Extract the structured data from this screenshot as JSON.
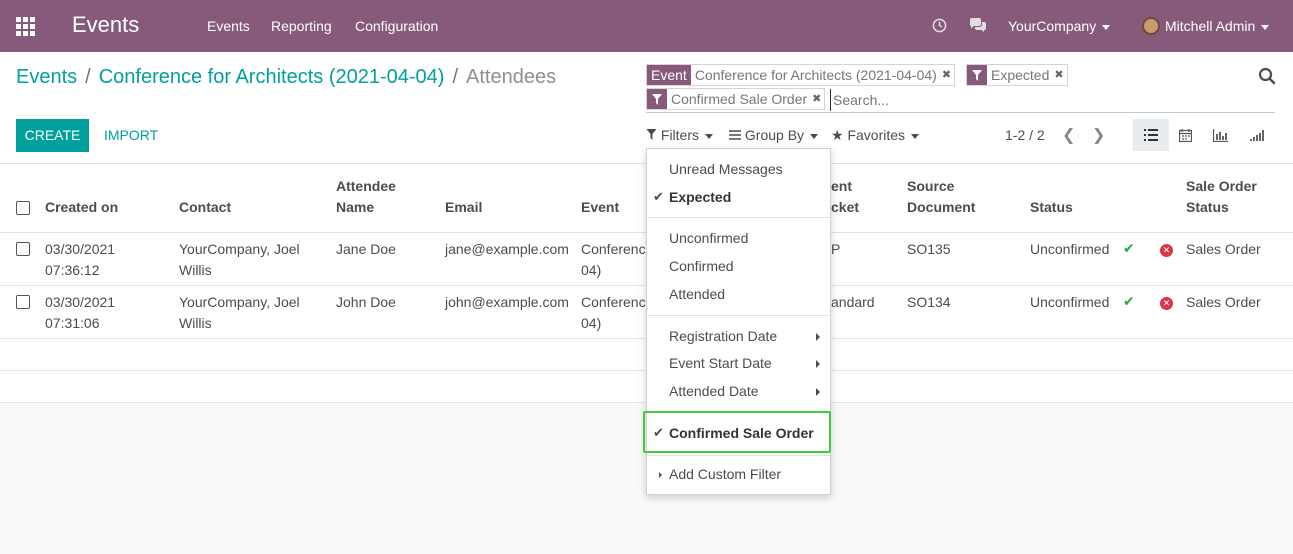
{
  "navbar": {
    "brand": "Events",
    "menu": [
      "Events",
      "Reporting",
      "Configuration"
    ],
    "company": "YourCompany",
    "user": "Mitchell Admin"
  },
  "breadcrumb": {
    "root": "Events",
    "event": "Conference for Architects (2021-04-04)",
    "current": "Attendees"
  },
  "buttons": {
    "create": "CREATE",
    "import": "IMPORT"
  },
  "search": {
    "facets": [
      {
        "category": "Event",
        "value": "Conference for Architects (2021-04-04)"
      },
      {
        "category": "filter-icon",
        "value": "Expected"
      },
      {
        "category": "filter-icon",
        "value": "Confirmed Sale Order"
      }
    ],
    "placeholder": "Search..."
  },
  "toolbar": {
    "filters": "Filters",
    "group_by": "Group By",
    "favorites": "Favorites"
  },
  "pager": {
    "range": "1-2 / 2"
  },
  "table": {
    "columns": [
      "Created on",
      "Contact",
      "Attendee Name",
      "Email",
      "Event",
      "Event Ticket",
      "Source Document",
      "Status",
      "Sale Order Status"
    ],
    "header_lines": {
      "attendee": [
        "Attendee",
        "Name"
      ],
      "ticket": [
        "ent",
        "cket"
      ],
      "source": [
        "Source",
        "Document"
      ],
      "so_status": [
        "Sale Order",
        "Status"
      ]
    },
    "rows": [
      {
        "created_date": "03/30/2021",
        "created_time": "07:36:12",
        "contact_1": "YourCompany, Joel",
        "contact_2": "Willis",
        "name": "Jane Doe",
        "email": "jane@example.com",
        "event_1": "Conferenc",
        "event_2": "04)",
        "ticket": "P",
        "source": "SO135",
        "status": "Unconfirmed",
        "so_status": "Sales Order"
      },
      {
        "created_date": "03/30/2021",
        "created_time": "07:31:06",
        "contact_1": "YourCompany, Joel",
        "contact_2": "Willis",
        "name": "John Doe",
        "email": "john@example.com",
        "event_1": "Conferenc",
        "event_2": "04)",
        "ticket": "andard",
        "source": "SO134",
        "status": "Unconfirmed",
        "so_status": "Sales Order"
      }
    ]
  },
  "filters_menu": {
    "group1": [
      {
        "label": "Unread Messages",
        "selected": false
      },
      {
        "label": "Expected",
        "selected": true
      }
    ],
    "group2": [
      {
        "label": "Unconfirmed",
        "selected": false
      },
      {
        "label": "Confirmed",
        "selected": false
      },
      {
        "label": "Attended",
        "selected": false
      }
    ],
    "group3": [
      {
        "label": "Registration Date"
      },
      {
        "label": "Event Start Date"
      },
      {
        "label": "Attended Date"
      }
    ],
    "group4": [
      {
        "label": "Confirmed Sale Order",
        "selected": true
      }
    ],
    "custom": "Add Custom Filter"
  },
  "colors": {
    "brand": "#875a7b",
    "accent": "#00a09d",
    "highlight": "#3fcc3f"
  }
}
